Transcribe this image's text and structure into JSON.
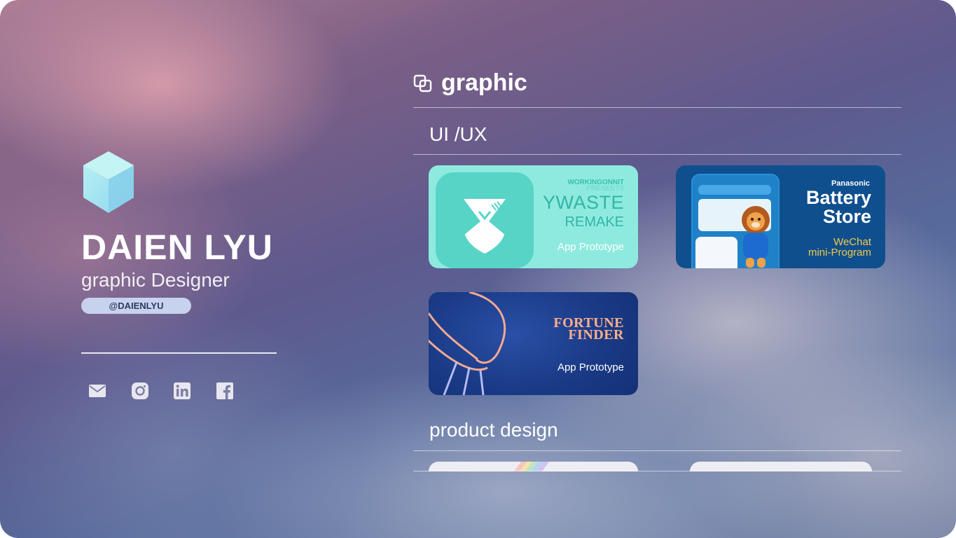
{
  "profile": {
    "name": "DAIEN LYU",
    "role": "graphic Designer",
    "handle": "@DAIENLYU",
    "social": [
      "mail-icon",
      "instagram-icon",
      "linkedin-icon",
      "facebook-icon"
    ]
  },
  "section": {
    "title": "graphic",
    "icon": "layers-icon"
  },
  "categories": {
    "uiux": "UI /UX",
    "product": "product design"
  },
  "cards": [
    {
      "presents_line1": "WORKINGONNIT",
      "presents_line2": "PRESENTS",
      "title_line1": "YWASTE",
      "title_line2": "REMAKE",
      "type": "App Prototype",
      "accent": "#8eeadf"
    },
    {
      "brand": "Panasonic",
      "title_line1": "Battery",
      "title_line2": "Store",
      "type_line1": "WeChat",
      "type_line2": "mini-Program",
      "accent": "#0f4f8e"
    },
    {
      "title_line1": "FORTUNE",
      "title_line2": "FINDER",
      "type": "App Prototype",
      "accent": "#1a3a86"
    }
  ]
}
